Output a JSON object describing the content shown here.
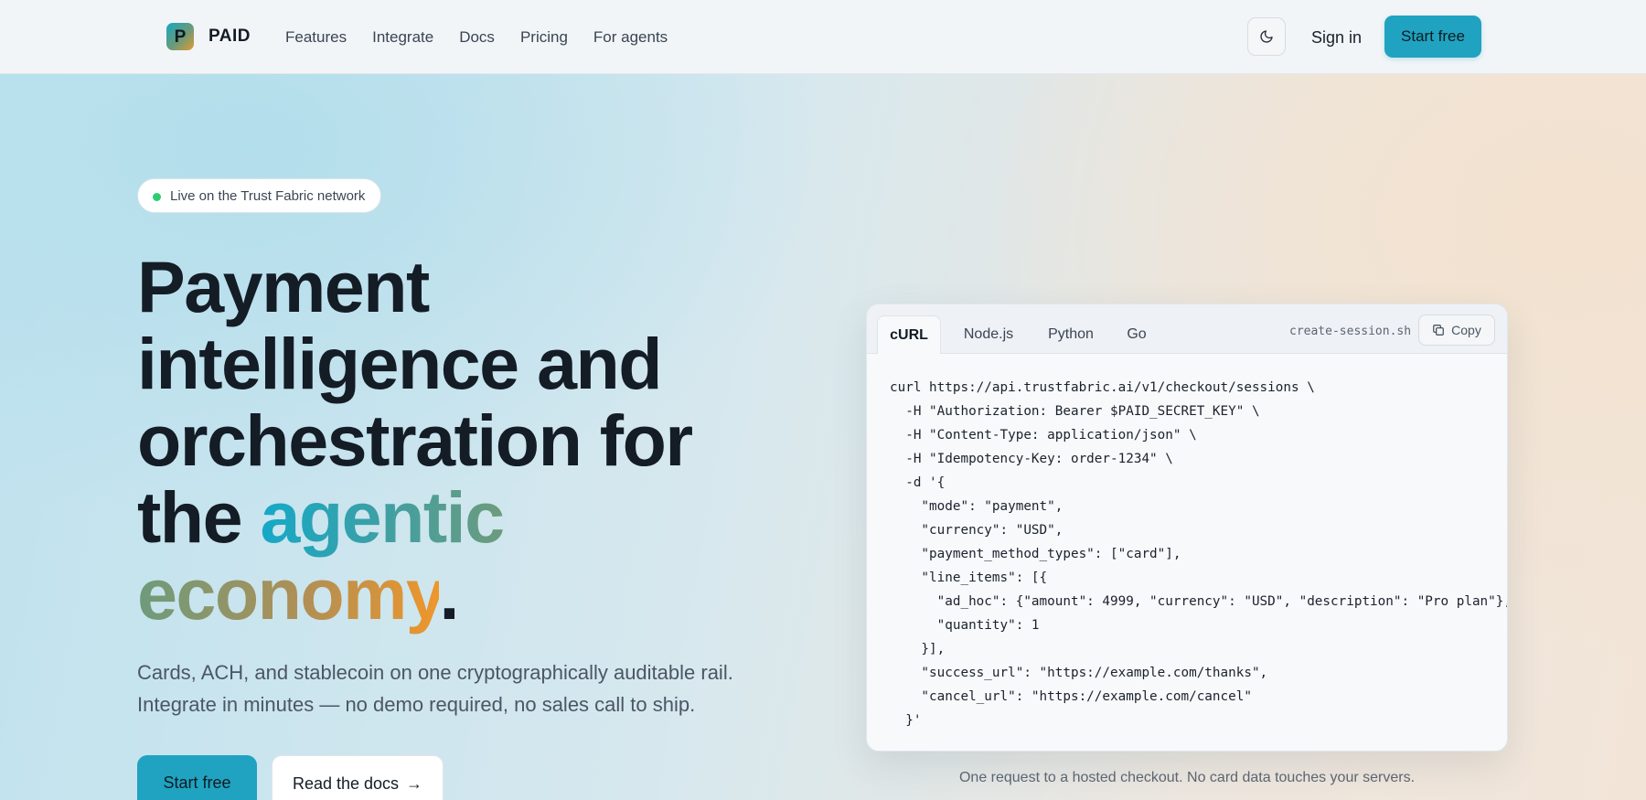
{
  "brand": {
    "logo_letter": "P",
    "name": "PAID"
  },
  "nav": {
    "links": [
      "Features",
      "Integrate",
      "Docs",
      "Pricing",
      "For agents"
    ],
    "theme_icon": "moon-icon",
    "signin_label": "Sign in",
    "cta_label": "Start free"
  },
  "hero": {
    "pill_text": "Live on the Trust Fabric network",
    "headline": {
      "line1": "Payment",
      "line2": "intelligence and",
      "line3": "orchestration for",
      "line4_plain": "the ",
      "line4_accent": "agentic",
      "line5_accent": "economy",
      "line5_end": "."
    },
    "subtext": {
      "line1": "Cards, ACH, and stablecoin on one cryptographically auditable rail.",
      "line2": "Integrate in minutes — no demo required, no sales call to ship."
    },
    "primary_button": "Start free",
    "secondary_button": "Read the docs",
    "secondary_arrow": "→"
  },
  "code_card": {
    "tabs": [
      "cURL",
      "Node.js",
      "Python",
      "Go"
    ],
    "active_tab": "cURL",
    "filename": "create-session.sh",
    "copy_label": "Copy",
    "lines": [
      "curl https://api.trustfabric.ai/v1/checkout/sessions \\",
      "  -H \"Authorization: Bearer $PAID_SECRET_KEY\" \\",
      "  -H \"Content-Type: application/json\" \\",
      "  -H \"Idempotency-Key: order-1234\" \\",
      "  -d '{",
      "    \"mode\": \"payment\",",
      "    \"currency\": \"USD\",",
      "    \"payment_method_types\": [\"card\"],",
      "    \"line_items\": [{",
      "      \"ad_hoc\": {\"amount\": 4999, \"currency\": \"USD\", \"description\": \"Pro plan\"},",
      "      \"quantity\": 1",
      "    }],",
      "    \"success_url\": \"https://example.com/thanks\",",
      "    \"cancel_url\": \"https://example.com/cancel\"",
      "  }'"
    ],
    "caption": "One request to a hosted checkout. No card data touches your servers."
  },
  "colors": {
    "accent": "#1fa3c0",
    "gradient_start": "#14a9c8",
    "gradient_end": "#ee962c",
    "status_dot": "#2ecc71"
  }
}
